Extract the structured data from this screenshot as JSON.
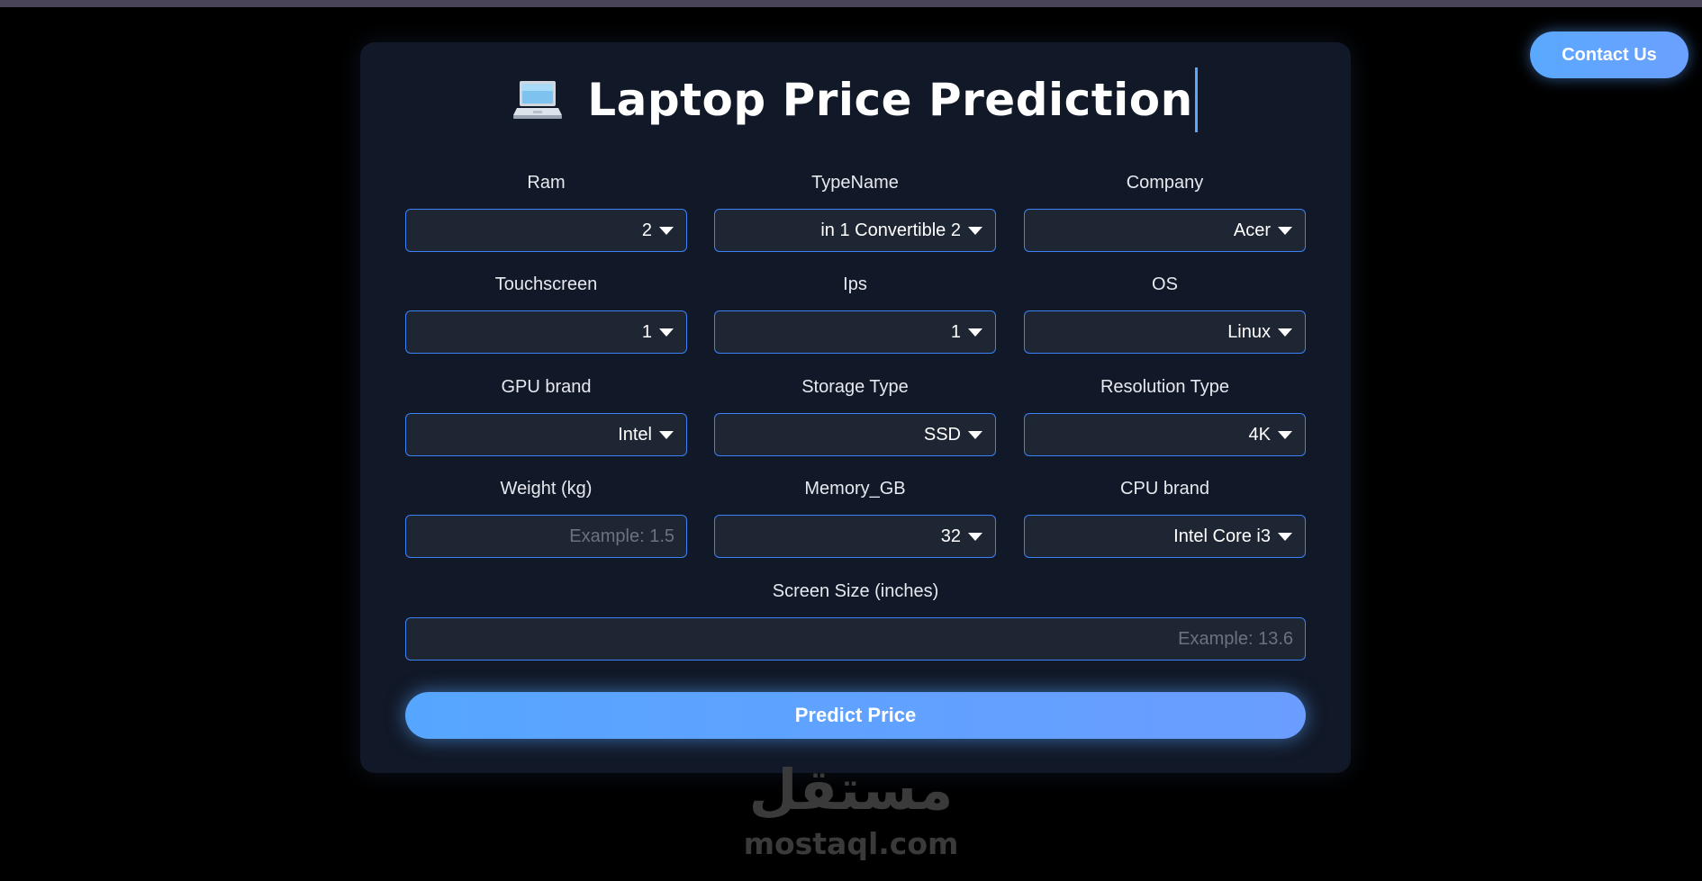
{
  "contact_label": "Contact Us",
  "title": "Laptop Price Prediction",
  "title_icon": "laptop-icon",
  "fields": {
    "ram": {
      "label": "Ram",
      "value": "2"
    },
    "typename": {
      "label": "TypeName",
      "value": "in 1 Convertible 2"
    },
    "company": {
      "label": "Company",
      "value": "Acer"
    },
    "touchscreen": {
      "label": "Touchscreen",
      "value": "1"
    },
    "ips": {
      "label": "Ips",
      "value": "1"
    },
    "os": {
      "label": "OS",
      "value": "Linux"
    },
    "gpu_brand": {
      "label": "GPU brand",
      "value": "Intel"
    },
    "storage_type": {
      "label": "Storage Type",
      "value": "SSD"
    },
    "resolution_type": {
      "label": "Resolution Type",
      "value": "4K"
    },
    "weight": {
      "label": "Weight (kg)",
      "placeholder": "Example: 1.5"
    },
    "memory_gb": {
      "label": "Memory_GB",
      "value": "32"
    },
    "cpu_brand": {
      "label": "CPU brand",
      "value": "Intel Core i3"
    },
    "screen_size": {
      "label": "Screen Size (inches)",
      "placeholder": "Example: 13.6"
    }
  },
  "predict_label": "Predict Price",
  "watermark": {
    "arabic": "مستقل",
    "latin": "mostaql.com"
  },
  "colors": {
    "accent": "#3b82f6",
    "button": "#5aa8ff",
    "card": "#111827",
    "field_bg": "#1e2533"
  }
}
